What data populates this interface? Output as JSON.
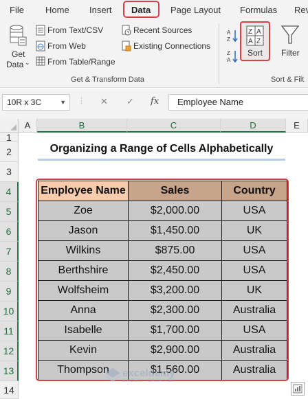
{
  "ribbon": {
    "tabs": [
      "File",
      "Home",
      "Insert",
      "Data",
      "Page Layout",
      "Formulas",
      "Rev"
    ],
    "active_tab": "Data",
    "get_data_label": "Get",
    "get_data_label2": "Data",
    "from_text_csv": "From Text/CSV",
    "from_web": "From Web",
    "from_table_range": "From Table/Range",
    "recent_sources": "Recent Sources",
    "existing_connections": "Existing Connections",
    "group_get_transform": "Get & Transform Data",
    "sort_label": "Sort",
    "filter_label": "Filter",
    "group_sort_filter": "Sort & Filt",
    "accent_color": "#217346",
    "highlight_color": "#d94148"
  },
  "formula_bar": {
    "name_box": "10R x 3C",
    "cancel_icon": "✕",
    "enter_icon": "✓",
    "fx_label": "fx",
    "formula": "Employee Name"
  },
  "grid": {
    "columns": [
      "A",
      "B",
      "C",
      "D",
      "E"
    ],
    "rows": [
      "1",
      "2",
      "3",
      "4",
      "5",
      "6",
      "7",
      "8",
      "9",
      "10",
      "11",
      "12",
      "13",
      "14"
    ]
  },
  "sheet": {
    "title": "Organizing a Range of Cells Alphabetically",
    "headers": [
      "Employee Name",
      "Sales",
      "Country"
    ],
    "header_colors": [
      "#f8cbad",
      "#c8a48a",
      "#c8a48a"
    ],
    "rows": [
      [
        "Zoe",
        "$2,000.00",
        "USA"
      ],
      [
        "Jason",
        "$1,450.00",
        "UK"
      ],
      [
        "Wilkins",
        "$875.00",
        "USA"
      ],
      [
        "Berthshire",
        "$2,450.00",
        "USA"
      ],
      [
        "Wolfsheim",
        "$3,200.00",
        "UK"
      ],
      [
        "Anna",
        "$2,300.00",
        "Australia"
      ],
      [
        "Isabelle",
        "$1,700.00",
        "USA"
      ],
      [
        "Kevin",
        "$2,900.00",
        "Australia"
      ],
      [
        "Thompson",
        "$1,560.00",
        "Australia"
      ]
    ]
  },
  "watermark": {
    "name": "exceldemy",
    "tagline": "EXCEL · DATA · BI"
  }
}
